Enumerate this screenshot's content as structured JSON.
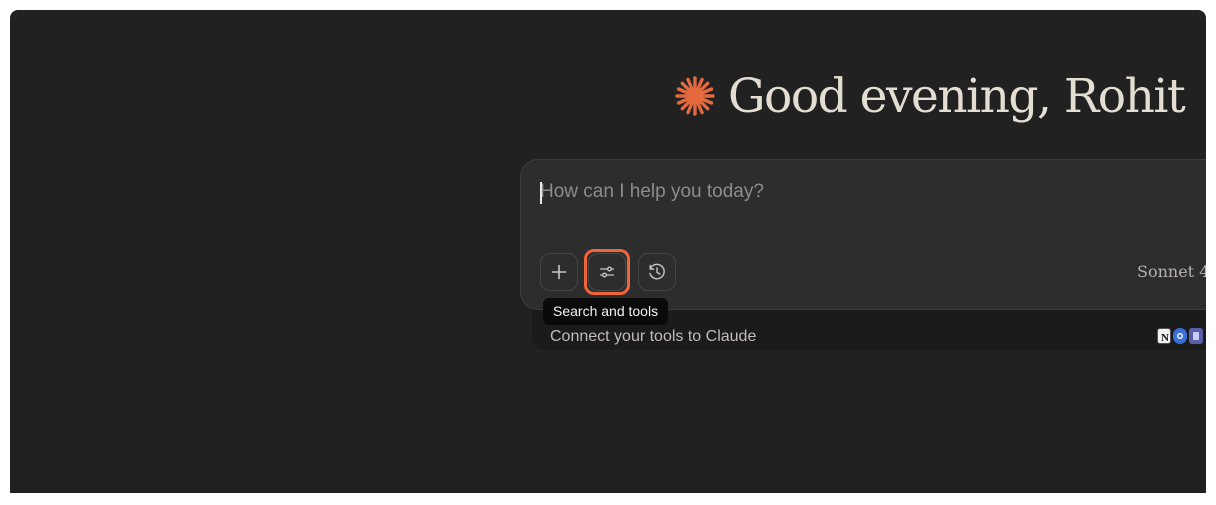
{
  "greeting": {
    "text": "Good evening, Rohit",
    "icon": "claude-starburst-icon",
    "icon_color": "#e5693f"
  },
  "composer": {
    "placeholder": "How can I help you today?",
    "value": "",
    "buttons": [
      {
        "icon": "plus-icon",
        "tooltip": ""
      },
      {
        "icon": "sliders-icon",
        "tooltip": "Search and tools"
      },
      {
        "icon": "history-clock-icon",
        "tooltip": ""
      }
    ],
    "model": "Sonnet 4"
  },
  "tooltip": {
    "text": "Search and tools"
  },
  "connect": {
    "text": "Connect your tools to Claude",
    "icons": [
      "notion-icon",
      "chrome-icon",
      "app-icon"
    ]
  },
  "colors": {
    "background": "#212121",
    "composer_bg": "#2d2d2d",
    "accent": "#f2643a",
    "greeting_text": "#e3ddd2"
  }
}
